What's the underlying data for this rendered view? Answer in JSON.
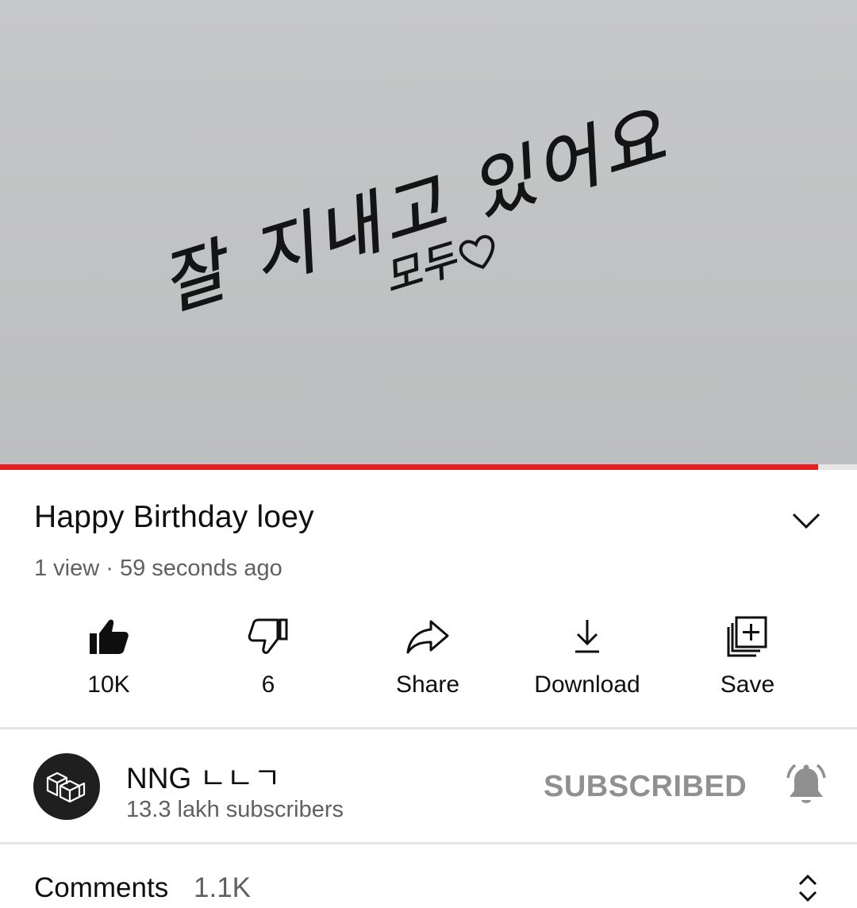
{
  "player": {
    "overlay_text": "잘 지내고 있어요",
    "overlay_subtext": "모두",
    "progress_fraction": 0.955
  },
  "video": {
    "title": "Happy Birthday loey",
    "views": "1 view",
    "separator": " · ",
    "time_ago": "59 seconds ago"
  },
  "actions": {
    "like_label": "10K",
    "dislike_label": "6",
    "share_label": "Share",
    "download_label": "Download",
    "save_label": "Save"
  },
  "channel": {
    "name": "NNG ㄴㄴㄱ",
    "subscribers": "13.3 lakh subscribers",
    "subscribe_status": "SUBSCRIBED"
  },
  "comments": {
    "label": "Comments",
    "count": "1.1K"
  },
  "colors": {
    "progress": "#e81d1d",
    "video_bg": "#c3c4c5",
    "muted_text": "#606060",
    "subscribed_text": "#909090"
  },
  "icons": {
    "expand": "chevron-down-icon",
    "like": "thumbs-up-filled-icon",
    "dislike": "thumbs-down-outline-icon",
    "share": "share-arrow-icon",
    "download": "download-icon",
    "save": "playlist-add-icon",
    "bell": "bell-filled-icon",
    "comments_toggle": "unfold-icon",
    "avatar": "channel-logo-icon"
  }
}
